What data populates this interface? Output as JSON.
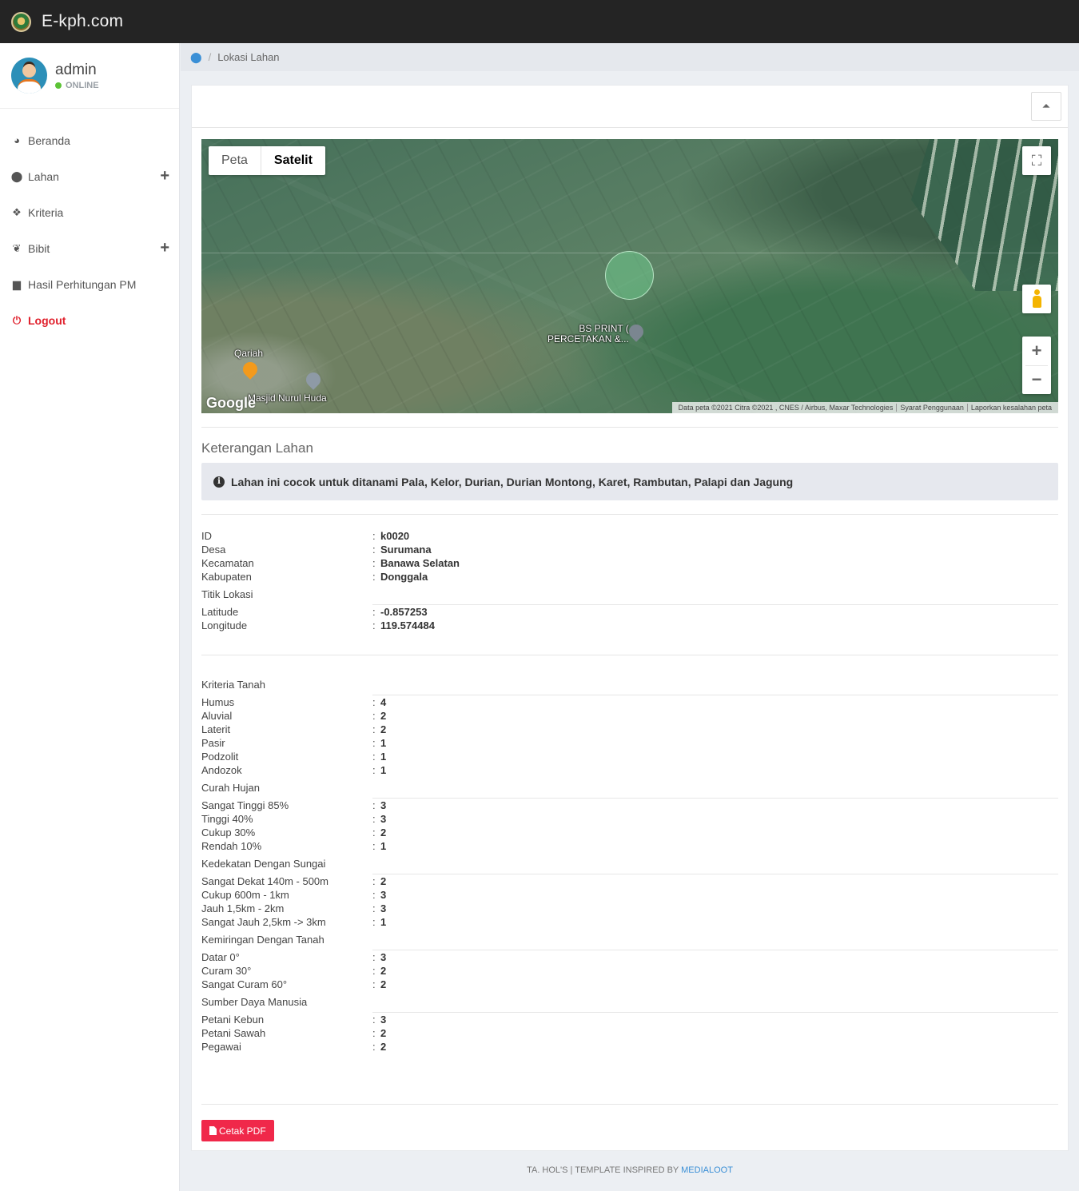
{
  "app": {
    "brand": "E-kph.com"
  },
  "user": {
    "name": "admin",
    "status": "ONLINE"
  },
  "menu": [
    {
      "label": "Beranda",
      "icon": "dashboard-icon",
      "expandable": false
    },
    {
      "label": "Lahan",
      "icon": "map-marker-icon",
      "expandable": true
    },
    {
      "label": "Kriteria",
      "icon": "cubes-icon",
      "expandable": false
    },
    {
      "label": "Bibit",
      "icon": "leaf-icon",
      "expandable": true
    },
    {
      "label": "Hasil Perhitungan PM",
      "icon": "bar-chart-icon",
      "expandable": false
    },
    {
      "label": "Logout",
      "icon": "power-icon",
      "expandable": false
    }
  ],
  "breadcrumb": {
    "current": "Lokasi Lahan"
  },
  "map": {
    "tabs": [
      "Peta",
      "Satelit"
    ],
    "active_tab": "Satelit",
    "places": [
      "BS PRINT (",
      "PERCETAKAN &...",
      "Qariah",
      "Masjid Nurul Huda"
    ],
    "logo": "Google",
    "attribution": [
      "Data peta ©2021 Citra ©2021 , CNES / Airbus, Maxar Technologies",
      "Syarat Penggunaan",
      "Laporkan kesalahan peta"
    ]
  },
  "keterangan": {
    "title": "Keterangan Lahan",
    "message": "Lahan ini cocok untuk ditanami Pala, Kelor, Durian, Durian Montong, Karet, Rambutan, Palapi dan Jagung"
  },
  "detail": [
    {
      "label": "ID",
      "value": "k0020"
    },
    {
      "label": "Desa",
      "value": "Surumana"
    },
    {
      "label": "Kecamatan",
      "value": "Banawa Selatan"
    },
    {
      "label": "Kabupaten",
      "value": "Donggala"
    }
  ],
  "titik": {
    "title": "Titik Lokasi",
    "rows": [
      {
        "label": "Latitude",
        "value": "-0.857253"
      },
      {
        "label": "Longitude",
        "value": "119.574484"
      }
    ]
  },
  "kriteria": [
    {
      "title": "Kriteria Tanah",
      "rows": [
        {
          "label": "Humus",
          "value": "4"
        },
        {
          "label": "Aluvial",
          "value": "2"
        },
        {
          "label": "Laterit",
          "value": "2"
        },
        {
          "label": "Pasir",
          "value": "1"
        },
        {
          "label": "Podzolit",
          "value": "1"
        },
        {
          "label": "Andozok",
          "value": "1"
        }
      ]
    },
    {
      "title": "Curah Hujan",
      "rows": [
        {
          "label": "Sangat Tinggi 85%",
          "value": "3"
        },
        {
          "label": "Tinggi 40%",
          "value": "3"
        },
        {
          "label": "Cukup 30%",
          "value": "2"
        },
        {
          "label": "Rendah 10%",
          "value": "1"
        }
      ]
    },
    {
      "title": "Kedekatan Dengan Sungai",
      "rows": [
        {
          "label": "Sangat Dekat 140m - 500m",
          "value": "2"
        },
        {
          "label": "Cukup 600m - 1km",
          "value": "3"
        },
        {
          "label": "Jauh 1,5km - 2km",
          "value": "3"
        },
        {
          "label": "Sangat Jauh 2,5km -> 3km",
          "value": "1"
        }
      ]
    },
    {
      "title": "Kemiringan Dengan Tanah",
      "rows": [
        {
          "label": "Datar 0°",
          "value": "3"
        },
        {
          "label": "Curam 30°",
          "value": "2"
        },
        {
          "label": "Sangat Curam 60°",
          "value": "2"
        }
      ]
    },
    {
      "title": "Sumber Daya Manusia",
      "rows": [
        {
          "label": "Petani Kebun",
          "value": "3"
        },
        {
          "label": "Petani Sawah",
          "value": "2"
        },
        {
          "label": "Pegawai",
          "value": "2"
        }
      ]
    }
  ],
  "actions": {
    "print_pdf": "Cetak PDF"
  },
  "footer": {
    "text": "TA. HOL'S | TEMPLATE INSPIRED BY",
    "link": "MEDIALOOT"
  },
  "colors": {
    "accent": "#f0284a",
    "link": "#3a8fd6",
    "online": "#5cc336",
    "topbar": "#242424"
  }
}
